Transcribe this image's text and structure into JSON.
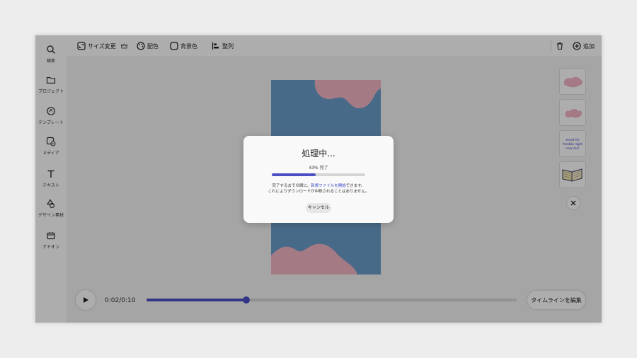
{
  "sidebar": {
    "items": [
      {
        "label": "検索",
        "icon": "search-icon"
      },
      {
        "label": "プロジェクト",
        "icon": "folder-icon"
      },
      {
        "label": "テンプレート",
        "icon": "template-icon"
      },
      {
        "label": "メディア",
        "icon": "media-icon"
      },
      {
        "label": "テキスト",
        "icon": "text-icon"
      },
      {
        "label": "デザイン素材",
        "icon": "shapes-icon"
      },
      {
        "label": "アドオン",
        "icon": "addon-icon"
      }
    ]
  },
  "toolbar": {
    "resize_label": "サイズ変更",
    "color_label": "配色",
    "background_label": "背景色",
    "align_label": "整列",
    "add_label": "追加"
  },
  "player": {
    "time": "0:02/0:10",
    "progress": 0.27,
    "timeline_label": "タイムラインを編集"
  },
  "modal": {
    "title": "処理中...",
    "percent_text": "43% 完了",
    "progress": 0.47,
    "message_prefix": "完了するまでの間に、",
    "message_link": "新規ファイルを開始",
    "message_suffix": "できます。",
    "message_line2": "これによりダウンロードが中断されることはありません。",
    "cancel_label": "キャンセル"
  },
  "thumbnail_text": "shoot for freebie right now me!",
  "colors": {
    "accent": "#4a4fc4",
    "design_bg": "#6b9cca",
    "blob": "#f2b4c4"
  }
}
